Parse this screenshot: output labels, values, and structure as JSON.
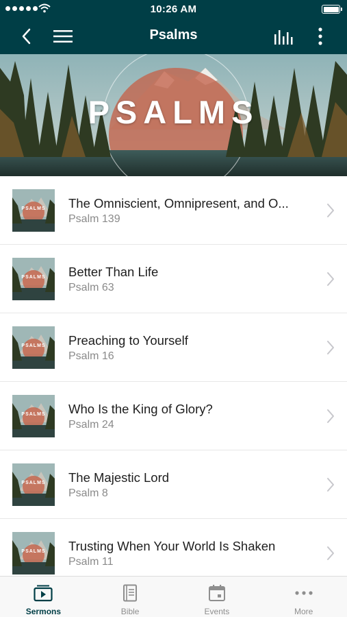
{
  "status_bar": {
    "time": "10:26 AM"
  },
  "nav": {
    "title": "Psalms"
  },
  "hero": {
    "title": "PSALMS"
  },
  "thumb_label": "PSALMS",
  "sermons": [
    {
      "title": "The Omniscient, Omnipresent, and O...",
      "subtitle": "Psalm 139"
    },
    {
      "title": "Better Than Life",
      "subtitle": "Psalm 63"
    },
    {
      "title": "Preaching to Yourself",
      "subtitle": "Psalm 16"
    },
    {
      "title": "Who Is the King of Glory?",
      "subtitle": "Psalm 24"
    },
    {
      "title": "The Majestic Lord",
      "subtitle": "Psalm 8"
    },
    {
      "title": "Trusting When Your World Is Shaken",
      "subtitle": "Psalm 11"
    }
  ],
  "tabs": [
    {
      "label": "Sermons",
      "icon": "sermons-play-icon",
      "active": true
    },
    {
      "label": "Bible",
      "icon": "bible-icon",
      "active": false
    },
    {
      "label": "Events",
      "icon": "calendar-icon",
      "active": false
    },
    {
      "label": "More",
      "icon": "more-dots-icon",
      "active": false
    }
  ],
  "colors": {
    "header": "#003e46",
    "active_tab": "#003e46",
    "inactive_tab": "#8e8e8e"
  }
}
